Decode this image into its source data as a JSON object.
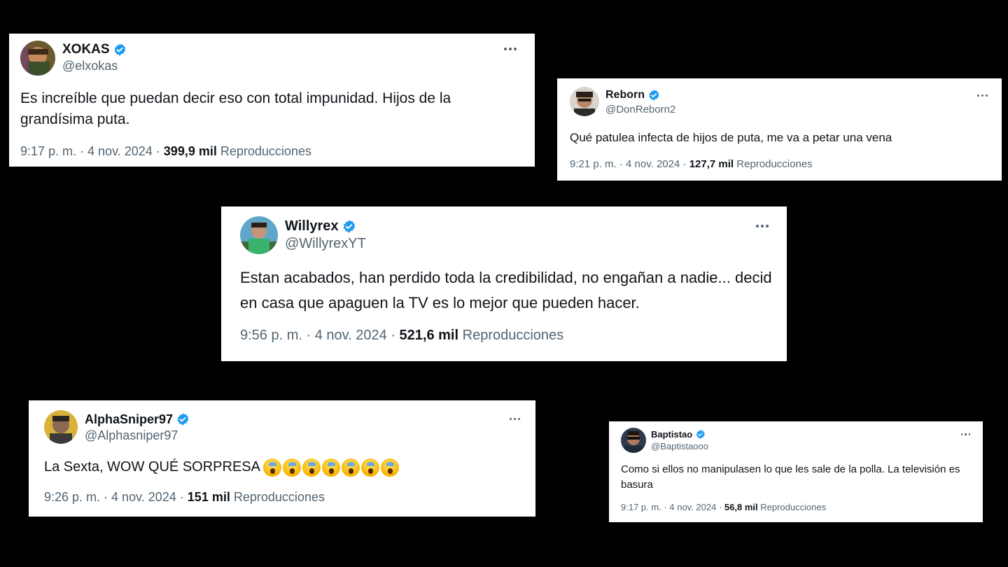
{
  "colors": {
    "background": "#000000",
    "card": "#ffffff",
    "text_primary": "#0f1419",
    "text_secondary": "#536471",
    "verified_blue": "#1d9bf0"
  },
  "tweets": [
    {
      "name": "XOKAS",
      "handle": "@elxokas",
      "verified": true,
      "text": "Es increíble que puedan decir eso con total impunidad. Hijos de la grandísima puta.",
      "time": "9:17 p. m.",
      "date": "4 nov. 2024",
      "views": "399,9 mil",
      "views_label": "Reproducciones",
      "icon": "more-options-icon"
    },
    {
      "name": "Reborn",
      "handle": "@DonReborn2",
      "verified": true,
      "text": "Qué patulea infecta de hijos de puta, me va a petar una vena",
      "time": "9:21 p. m.",
      "date": "4 nov. 2024",
      "views": "127,7 mil",
      "views_label": "Reproducciones",
      "icon": "more-options-icon"
    },
    {
      "name": "Willyrex",
      "handle": "@WillyrexYT",
      "verified": true,
      "text": "Estan acabados, han perdido toda la credibilidad, no engañan a nadie... decid en casa que apaguen la TV es lo mejor que pueden hacer.",
      "time": "9:56 p. m.",
      "date": "4 nov. 2024",
      "views": "521,6 mil",
      "views_label": "Reproducciones",
      "icon": "more-options-icon"
    },
    {
      "name": "AlphaSniper97",
      "handle": "@Alphasniper97",
      "verified": true,
      "text": "La Sexta, WOW QUÉ SORPRESA",
      "emoji": "screaming-face-emoji",
      "emoji_count": 7,
      "time": "9:26 p. m.",
      "date": "4 nov. 2024",
      "views": "151 mil",
      "views_label": "Reproducciones",
      "icon": "more-options-icon"
    },
    {
      "name": "Baptistao",
      "handle": "@Baptistaooo",
      "verified": true,
      "text": "Como si ellos no manipulasen lo que les sale de la polla. La televisión es basura",
      "time": "9:17 p. m.",
      "date": "4 nov. 2024",
      "views": "56,8 mil",
      "views_label": "Reproducciones",
      "icon": "more-options-icon"
    }
  ]
}
